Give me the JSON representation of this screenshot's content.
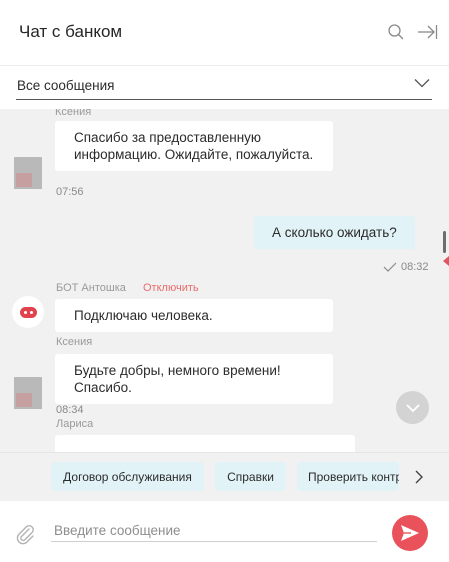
{
  "header": {
    "title": "Чат с банком",
    "search_icon": "search-icon",
    "collapse_icon": "collapse-right-icon"
  },
  "filter": {
    "selected": "Все сообщения",
    "icon": "chevron-down-icon"
  },
  "messages": [
    {
      "sender": "Ксения",
      "text": "Спасибо за предоставленную информацию. Ожидайте, пожалуйста.",
      "time": "07:56",
      "direction": "in"
    },
    {
      "text": "А сколько ожидать?",
      "time": "08:32",
      "direction": "out",
      "status_icon": "checkmark-icon"
    },
    {
      "sender": "БОТ Антошка",
      "action": "Отключить",
      "text": "Подключаю человека.",
      "direction": "in"
    },
    {
      "sender": "Ксения",
      "text": "Будьте добры, немного времени! Спасибо.",
      "time": "08:34",
      "direction": "in"
    },
    {
      "sender": "Лариса",
      "text": "",
      "direction": "in"
    }
  ],
  "quick_replies": [
    "Договор обслуживания",
    "Справки",
    "Проверить контр"
  ],
  "composer": {
    "placeholder": "Введите сообщение",
    "attach_icon": "paperclip-icon",
    "send_icon": "send-icon"
  },
  "colors": {
    "accent": "#e9525b",
    "out_bubble": "#e2f3f7",
    "chat_bg": "#f1f1f1",
    "link_red": "#ea6b6b"
  }
}
